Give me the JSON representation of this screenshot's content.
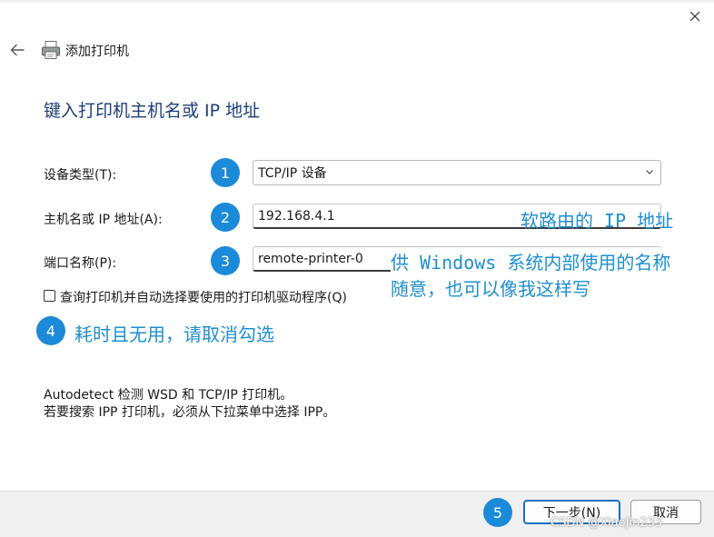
{
  "window": {
    "title": "添加打印机"
  },
  "heading": "键入打印机主机名或 IP 地址",
  "form": {
    "device_type_label": "设备类型(T):",
    "device_type_value": "TCP/IP 设备",
    "hostname_label": "主机名或 IP 地址(A):",
    "hostname_value": "192.168.4.1",
    "port_label": "端口名称(P):",
    "port_value": "remote-printer-0",
    "query_checkbox_label": "查询打印机并自动选择要使用的打印机驱动程序(Q)",
    "query_checked": false
  },
  "annotations": {
    "badge_1": "1",
    "badge_2": "2",
    "badge_3": "3",
    "badge_4": "4",
    "badge_5": "5",
    "note_ip": "软路由的 IP 地址",
    "note_port_line1": "供 Windows 系统内部使用的名称",
    "note_port_line2": "随意，也可以像我这样写",
    "note_checkbox": "耗时且无用，请取消勾选"
  },
  "info": {
    "line1": "Autodetect 检测 WSD 和 TCP/IP 打印机。",
    "line2": "若要搜索 IPP 打印机，必须从下拉菜单中选择 IPP。"
  },
  "buttons": {
    "next": "下一步(N)",
    "cancel": "取消"
  },
  "watermark": "CSDN @XiaoJin233",
  "icons": {
    "close": "close-icon",
    "back": "back-arrow-icon",
    "printer": "printer-icon",
    "dropdown": "chevron-down-icon"
  },
  "colors": {
    "heading": "#1e3f7a",
    "annotation": "#1e8fcf",
    "badge": "#1b8ad8",
    "primary_button_border": "#1a6fc0"
  }
}
